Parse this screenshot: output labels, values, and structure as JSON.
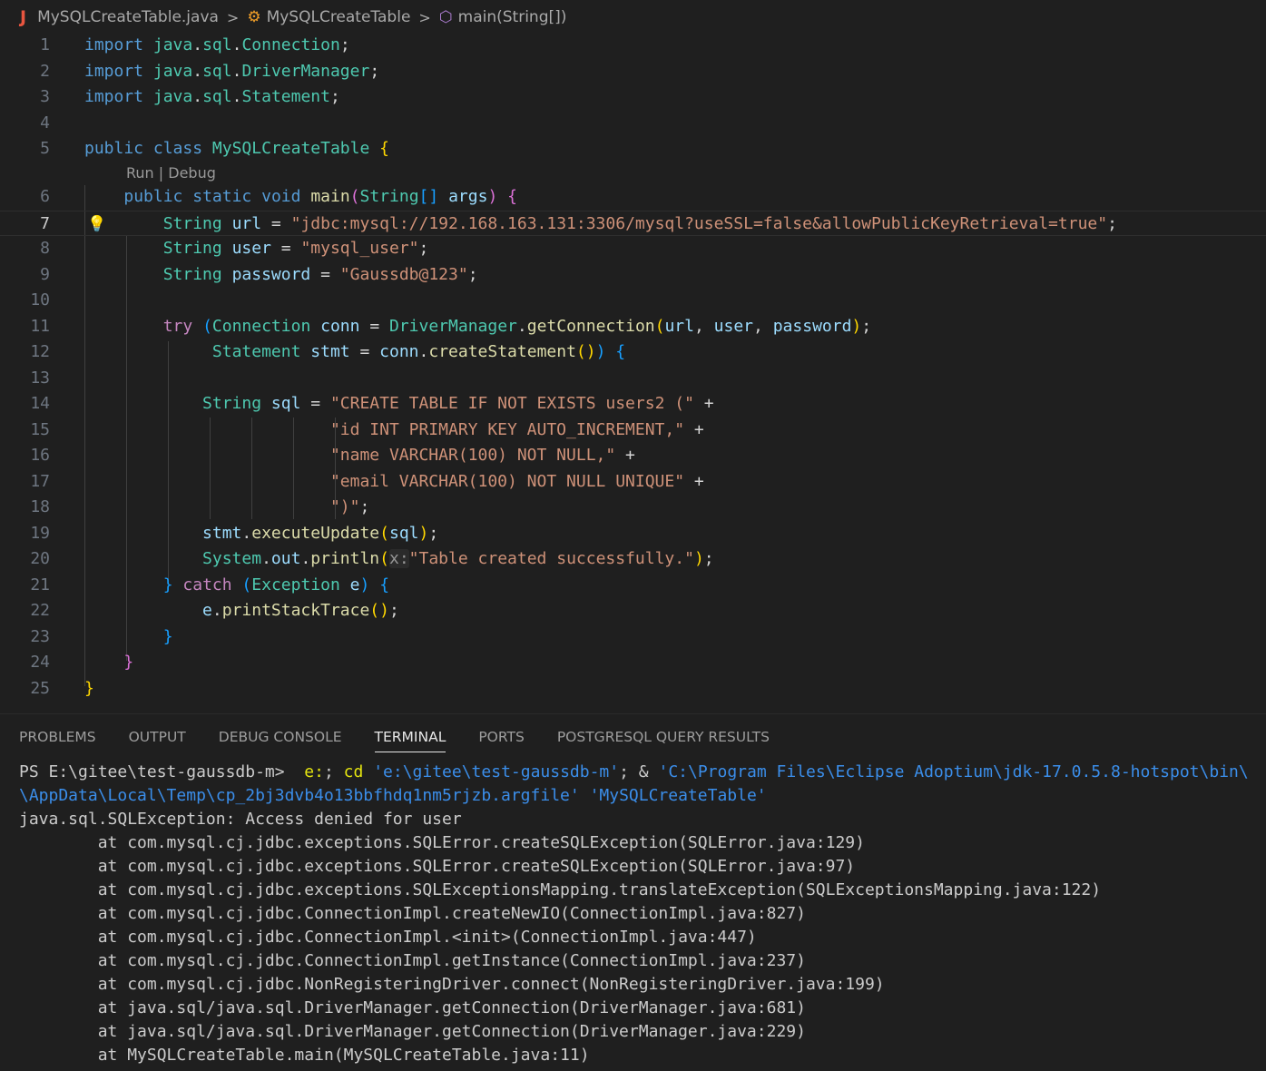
{
  "breadcrumb": {
    "file": "MySQLCreateTable.java",
    "class": "MySQLCreateTable",
    "method": "main(String[])"
  },
  "editor": {
    "current_line": 7,
    "codelens": "Run | Debug",
    "lines": [
      {
        "n": "1",
        "tokens": [
          {
            "c": "k",
            "t": "import"
          },
          {
            "c": "p",
            "t": " "
          },
          {
            "c": "t",
            "t": "java"
          },
          {
            "c": "p",
            "t": "."
          },
          {
            "c": "t",
            "t": "sql"
          },
          {
            "c": "p",
            "t": "."
          },
          {
            "c": "t",
            "t": "Connection"
          },
          {
            "c": "p",
            "t": ";"
          }
        ]
      },
      {
        "n": "2",
        "tokens": [
          {
            "c": "k",
            "t": "import"
          },
          {
            "c": "p",
            "t": " "
          },
          {
            "c": "t",
            "t": "java"
          },
          {
            "c": "p",
            "t": "."
          },
          {
            "c": "t",
            "t": "sql"
          },
          {
            "c": "p",
            "t": "."
          },
          {
            "c": "t",
            "t": "DriverManager"
          },
          {
            "c": "p",
            "t": ";"
          }
        ]
      },
      {
        "n": "3",
        "tokens": [
          {
            "c": "k",
            "t": "import"
          },
          {
            "c": "p",
            "t": " "
          },
          {
            "c": "t",
            "t": "java"
          },
          {
            "c": "p",
            "t": "."
          },
          {
            "c": "t",
            "t": "sql"
          },
          {
            "c": "p",
            "t": "."
          },
          {
            "c": "t",
            "t": "Statement"
          },
          {
            "c": "p",
            "t": ";"
          }
        ]
      },
      {
        "n": "4",
        "tokens": []
      },
      {
        "n": "5",
        "tokens": [
          {
            "c": "k",
            "t": "public"
          },
          {
            "c": "p",
            "t": " "
          },
          {
            "c": "k",
            "t": "class"
          },
          {
            "c": "p",
            "t": " "
          },
          {
            "c": "t",
            "t": "MySQLCreateTable"
          },
          {
            "c": "p",
            "t": " "
          },
          {
            "c": "b1",
            "t": "{"
          }
        ]
      },
      {
        "n": "6",
        "tokens": [
          {
            "c": "p",
            "t": "    "
          },
          {
            "c": "k",
            "t": "public"
          },
          {
            "c": "p",
            "t": " "
          },
          {
            "c": "k",
            "t": "static"
          },
          {
            "c": "p",
            "t": " "
          },
          {
            "c": "k",
            "t": "void"
          },
          {
            "c": "p",
            "t": " "
          },
          {
            "c": "f",
            "t": "main"
          },
          {
            "c": "b2",
            "t": "("
          },
          {
            "c": "t",
            "t": "String"
          },
          {
            "c": "b3",
            "t": "[]"
          },
          {
            "c": "p",
            "t": " "
          },
          {
            "c": "v",
            "t": "args"
          },
          {
            "c": "b2",
            "t": ")"
          },
          {
            "c": "p",
            "t": " "
          },
          {
            "c": "b2",
            "t": "{"
          }
        ]
      },
      {
        "n": "7",
        "tokens": [
          {
            "c": "p",
            "t": "        "
          },
          {
            "c": "t",
            "t": "String"
          },
          {
            "c": "p",
            "t": " "
          },
          {
            "c": "v",
            "t": "url"
          },
          {
            "c": "p",
            "t": " = "
          },
          {
            "c": "s",
            "t": "\"jdbc:mysql://192.168.163.131:3306/mysql?useSSL=false&allowPublicKeyRetrieval=true\""
          },
          {
            "c": "p",
            "t": ";"
          }
        ]
      },
      {
        "n": "8",
        "tokens": [
          {
            "c": "p",
            "t": "        "
          },
          {
            "c": "t",
            "t": "String"
          },
          {
            "c": "p",
            "t": " "
          },
          {
            "c": "v",
            "t": "user"
          },
          {
            "c": "p",
            "t": " = "
          },
          {
            "c": "s",
            "t": "\"mysql_user\""
          },
          {
            "c": "p",
            "t": ";"
          }
        ]
      },
      {
        "n": "9",
        "tokens": [
          {
            "c": "p",
            "t": "        "
          },
          {
            "c": "t",
            "t": "String"
          },
          {
            "c": "p",
            "t": " "
          },
          {
            "c": "v",
            "t": "password"
          },
          {
            "c": "p",
            "t": " = "
          },
          {
            "c": "s",
            "t": "\"Gaussdb@123\""
          },
          {
            "c": "p",
            "t": ";"
          }
        ]
      },
      {
        "n": "10",
        "tokens": []
      },
      {
        "n": "11",
        "tokens": [
          {
            "c": "p",
            "t": "        "
          },
          {
            "c": "kc",
            "t": "try"
          },
          {
            "c": "p",
            "t": " "
          },
          {
            "c": "b3",
            "t": "("
          },
          {
            "c": "t",
            "t": "Connection"
          },
          {
            "c": "p",
            "t": " "
          },
          {
            "c": "v",
            "t": "conn"
          },
          {
            "c": "p",
            "t": " = "
          },
          {
            "c": "t",
            "t": "DriverManager"
          },
          {
            "c": "p",
            "t": "."
          },
          {
            "c": "f",
            "t": "getConnection"
          },
          {
            "c": "b1",
            "t": "("
          },
          {
            "c": "v",
            "t": "url"
          },
          {
            "c": "p",
            "t": ", "
          },
          {
            "c": "v",
            "t": "user"
          },
          {
            "c": "p",
            "t": ", "
          },
          {
            "c": "v",
            "t": "password"
          },
          {
            "c": "b1",
            "t": ")"
          },
          {
            "c": "p",
            "t": ";"
          }
        ]
      },
      {
        "n": "12",
        "tokens": [
          {
            "c": "p",
            "t": "             "
          },
          {
            "c": "t",
            "t": "Statement"
          },
          {
            "c": "p",
            "t": " "
          },
          {
            "c": "v",
            "t": "stmt"
          },
          {
            "c": "p",
            "t": " = "
          },
          {
            "c": "v",
            "t": "conn"
          },
          {
            "c": "p",
            "t": "."
          },
          {
            "c": "f",
            "t": "createStatement"
          },
          {
            "c": "b1",
            "t": "()"
          },
          {
            "c": "b3",
            "t": ")"
          },
          {
            "c": "p",
            "t": " "
          },
          {
            "c": "b3",
            "t": "{"
          }
        ]
      },
      {
        "n": "13",
        "tokens": []
      },
      {
        "n": "14",
        "tokens": [
          {
            "c": "p",
            "t": "            "
          },
          {
            "c": "t",
            "t": "String"
          },
          {
            "c": "p",
            "t": " "
          },
          {
            "c": "v",
            "t": "sql"
          },
          {
            "c": "p",
            "t": " = "
          },
          {
            "c": "s",
            "t": "\"CREATE TABLE IF NOT EXISTS users2 (\""
          },
          {
            "c": "p",
            "t": " +"
          }
        ]
      },
      {
        "n": "15",
        "tokens": [
          {
            "c": "p",
            "t": "                         "
          },
          {
            "c": "s",
            "t": "\"id INT PRIMARY KEY AUTO_INCREMENT,\""
          },
          {
            "c": "p",
            "t": " +"
          }
        ]
      },
      {
        "n": "16",
        "tokens": [
          {
            "c": "p",
            "t": "                         "
          },
          {
            "c": "s",
            "t": "\"name VARCHAR(100) NOT NULL,\""
          },
          {
            "c": "p",
            "t": " +"
          }
        ]
      },
      {
        "n": "17",
        "tokens": [
          {
            "c": "p",
            "t": "                         "
          },
          {
            "c": "s",
            "t": "\"email VARCHAR(100) NOT NULL UNIQUE\""
          },
          {
            "c": "p",
            "t": " +"
          }
        ]
      },
      {
        "n": "18",
        "tokens": [
          {
            "c": "p",
            "t": "                         "
          },
          {
            "c": "s",
            "t": "\")\""
          },
          {
            "c": "p",
            "t": ";"
          }
        ]
      },
      {
        "n": "19",
        "tokens": [
          {
            "c": "p",
            "t": "            "
          },
          {
            "c": "v",
            "t": "stmt"
          },
          {
            "c": "p",
            "t": "."
          },
          {
            "c": "f",
            "t": "executeUpdate"
          },
          {
            "c": "b1",
            "t": "("
          },
          {
            "c": "v",
            "t": "sql"
          },
          {
            "c": "b1",
            "t": ")"
          },
          {
            "c": "p",
            "t": ";"
          }
        ]
      },
      {
        "n": "20",
        "tokens": [
          {
            "c": "p",
            "t": "            "
          },
          {
            "c": "t",
            "t": "System"
          },
          {
            "c": "p",
            "t": "."
          },
          {
            "c": "v",
            "t": "out"
          },
          {
            "c": "p",
            "t": "."
          },
          {
            "c": "f",
            "t": "println"
          },
          {
            "c": "b1",
            "t": "("
          },
          {
            "c": "hint",
            "t": "x:"
          },
          {
            "c": "s",
            "t": "\"Table created successfully.\""
          },
          {
            "c": "b1",
            "t": ")"
          },
          {
            "c": "p",
            "t": ";"
          }
        ]
      },
      {
        "n": "21",
        "tokens": [
          {
            "c": "p",
            "t": "        "
          },
          {
            "c": "b3",
            "t": "}"
          },
          {
            "c": "p",
            "t": " "
          },
          {
            "c": "kc",
            "t": "catch"
          },
          {
            "c": "p",
            "t": " "
          },
          {
            "c": "b3",
            "t": "("
          },
          {
            "c": "t",
            "t": "Exception"
          },
          {
            "c": "p",
            "t": " "
          },
          {
            "c": "v",
            "t": "e"
          },
          {
            "c": "b3",
            "t": ")"
          },
          {
            "c": "p",
            "t": " "
          },
          {
            "c": "b3",
            "t": "{"
          }
        ]
      },
      {
        "n": "22",
        "tokens": [
          {
            "c": "p",
            "t": "            "
          },
          {
            "c": "v",
            "t": "e"
          },
          {
            "c": "p",
            "t": "."
          },
          {
            "c": "f",
            "t": "printStackTrace"
          },
          {
            "c": "b1",
            "t": "()"
          },
          {
            "c": "p",
            "t": ";"
          }
        ]
      },
      {
        "n": "23",
        "tokens": [
          {
            "c": "p",
            "t": "        "
          },
          {
            "c": "b3",
            "t": "}"
          }
        ]
      },
      {
        "n": "24",
        "tokens": [
          {
            "c": "p",
            "t": "    "
          },
          {
            "c": "b2",
            "t": "}"
          }
        ]
      },
      {
        "n": "25",
        "tokens": [
          {
            "c": "b1",
            "t": "}"
          }
        ]
      }
    ]
  },
  "panel": {
    "tabs": [
      {
        "label": "PROBLEMS",
        "active": false
      },
      {
        "label": "OUTPUT",
        "active": false
      },
      {
        "label": "DEBUG CONSOLE",
        "active": false
      },
      {
        "label": "TERMINAL",
        "active": true
      },
      {
        "label": "PORTS",
        "active": false
      },
      {
        "label": "POSTGRESQL QUERY RESULTS",
        "active": false
      }
    ]
  },
  "terminal": {
    "lines": [
      [
        {
          "c": "",
          "t": "PS E:\\gitee\\test-gaussdb-m>  "
        },
        {
          "c": "tyellow",
          "t": "e:"
        },
        {
          "c": "",
          "t": "; "
        },
        {
          "c": "tyellow",
          "t": "cd"
        },
        {
          "c": "",
          "t": " "
        },
        {
          "c": "tblue",
          "t": "'e:\\gitee\\test-gaussdb-m'"
        },
        {
          "c": "",
          "t": "; & "
        },
        {
          "c": "tblue",
          "t": "'C:\\Program Files\\Eclipse Adoptium\\jdk-17.0.5.8-hotspot\\bin\\"
        }
      ],
      [
        {
          "c": "tblue",
          "t": "\\AppData\\Local\\Temp\\cp_2bj3dvb4o13bbfhdq1nm5rjzb.argfile'"
        },
        {
          "c": "",
          "t": " "
        },
        {
          "c": "tblue",
          "t": "'MySQLCreateTable'"
        }
      ],
      [
        {
          "c": "",
          "t": "java.sql.SQLException: Access denied for user"
        }
      ],
      [
        {
          "c": "",
          "t": "        at com.mysql.cj.jdbc.exceptions.SQLError.createSQLException(SQLError.java:129)"
        }
      ],
      [
        {
          "c": "",
          "t": "        at com.mysql.cj.jdbc.exceptions.SQLError.createSQLException(SQLError.java:97)"
        }
      ],
      [
        {
          "c": "",
          "t": "        at com.mysql.cj.jdbc.exceptions.SQLExceptionsMapping.translateException(SQLExceptionsMapping.java:122)"
        }
      ],
      [
        {
          "c": "",
          "t": "        at com.mysql.cj.jdbc.ConnectionImpl.createNewIO(ConnectionImpl.java:827)"
        }
      ],
      [
        {
          "c": "",
          "t": "        at com.mysql.cj.jdbc.ConnectionImpl.<init>(ConnectionImpl.java:447)"
        }
      ],
      [
        {
          "c": "",
          "t": "        at com.mysql.cj.jdbc.ConnectionImpl.getInstance(ConnectionImpl.java:237)"
        }
      ],
      [
        {
          "c": "",
          "t": "        at com.mysql.cj.jdbc.NonRegisteringDriver.connect(NonRegisteringDriver.java:199)"
        }
      ],
      [
        {
          "c": "",
          "t": "        at java.sql/java.sql.DriverManager.getConnection(DriverManager.java:681)"
        }
      ],
      [
        {
          "c": "",
          "t": "        at java.sql/java.sql.DriverManager.getConnection(DriverManager.java:229)"
        }
      ],
      [
        {
          "c": "",
          "t": "        at MySQLCreateTable.main(MySQLCreateTable.java:11)"
        }
      ]
    ]
  },
  "colors": {
    "background": "#1f1f1f",
    "keyword": "#569cd6",
    "type": "#4ec9b0",
    "string": "#ce9178"
  }
}
